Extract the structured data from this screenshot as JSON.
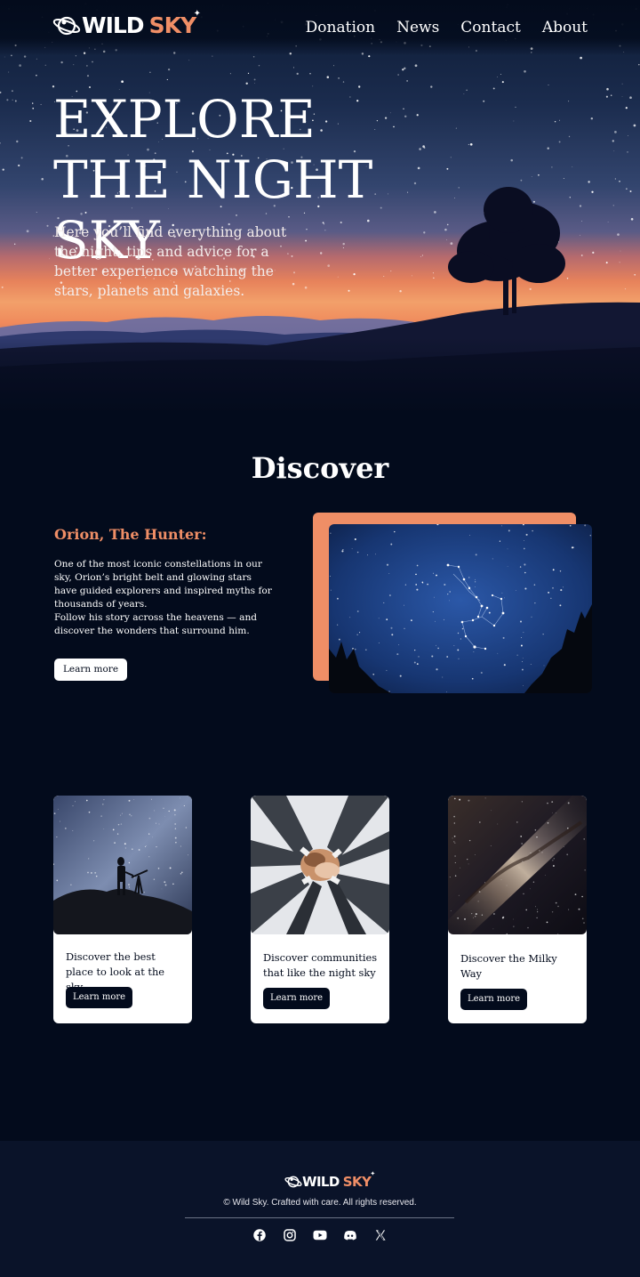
{
  "brand": {
    "name_primary": "WILD",
    "name_accent": "SKY",
    "spark": "✦"
  },
  "nav": {
    "items": [
      "Donation",
      "News",
      "Contact",
      "About"
    ]
  },
  "hero": {
    "title": "EXPLORE THE NIGHT SKY",
    "subtitle": "Here you’ll find everything about the night, tips and advice for a better experience watching the stars, planets and galaxies."
  },
  "discover": {
    "title": "Discover",
    "feature": {
      "heading": "Orion, The Hunter:",
      "paragraph1": "One of the most iconic constellations in our sky, Orion’s bright belt and glowing stars have guided explorers and inspired myths for thousands of years.",
      "paragraph2": "Follow his story across the heavens — and discover the wonders that surround him.",
      "button": "Learn more"
    }
  },
  "cards": [
    {
      "title": "Discover the best place to look at the sky",
      "button": "Learn more",
      "image": "stargazer-telescope-photo"
    },
    {
      "title": "Discover communities that like the night sky",
      "button": "Learn more",
      "image": "hands-together-photo"
    },
    {
      "title": "Discover the Milky Way",
      "button": "Learn more",
      "image": "milky-way-photo"
    }
  ],
  "footer": {
    "copyright": "© Wild Sky. Crafted with care. All rights reserved.",
    "socials": [
      "facebook-icon",
      "instagram-icon",
      "youtube-icon",
      "discord-icon",
      "x-icon"
    ]
  },
  "colors": {
    "background": "#030b1c",
    "accent": "#ef8e66",
    "footer": "#0a1329",
    "card": "#ffffff"
  }
}
